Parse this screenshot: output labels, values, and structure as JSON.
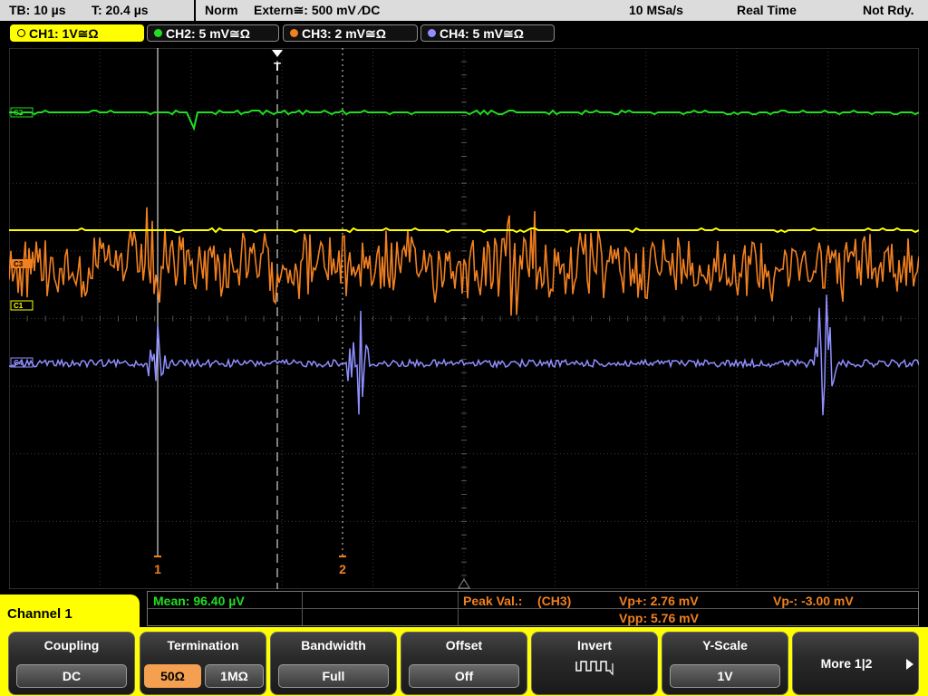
{
  "top": {
    "timebase": "TB: 10 µs",
    "trigger_pos": "T: 20.4 µs",
    "mode": "Norm",
    "trigger_src": "Extern≅: 500 mV ⁄DC",
    "sample_rate": "10 MSa/s",
    "acq_mode": "Real Time",
    "state": "Not Rdy."
  },
  "channels": [
    {
      "label": "CH1: 1V≅Ω",
      "color": "#ffff00",
      "active": true
    },
    {
      "label": "CH2: 5 mV≅Ω",
      "color": "#22dd22",
      "active": false
    },
    {
      "label": "CH3: 2 mV≅Ω",
      "color": "#f08020",
      "active": false
    },
    {
      "label": "CH4: 5 mV≅Ω",
      "color": "#8f8fff",
      "active": false
    }
  ],
  "markers": {
    "ch2": "C2",
    "ch3": "C3",
    "ch1": "C1",
    "ch4": "C4",
    "trigger": "T",
    "cursor1": "1",
    "cursor2": "2"
  },
  "measurements": {
    "mean": "Mean: 96.40 µV",
    "peak_label": "Peak Val.:",
    "peak_source": "(CH3)",
    "vp_plus": "Vp+: 2.76 mV",
    "vp_minus": "Vp-: -3.00 mV",
    "vpp": "Vpp: 5.76 mV"
  },
  "panel": {
    "title": "Channel 1"
  },
  "softkeys": {
    "coupling": {
      "title": "Coupling",
      "value": "DC"
    },
    "termination": {
      "title": "Termination",
      "opt1": "50Ω",
      "opt2": "1MΩ"
    },
    "bandwidth": {
      "title": "Bandwidth",
      "value": "Full"
    },
    "offset": {
      "title": "Offset",
      "value": "Off"
    },
    "invert": {
      "title": "Invert"
    },
    "yscale": {
      "title": "Y-Scale",
      "value": "1V"
    },
    "more": {
      "label": "More 1|2"
    }
  },
  "colors": {
    "ch1": "#ffff00",
    "ch2": "#22dd22",
    "ch3": "#f08020",
    "ch4": "#8f8fff",
    "accent": "#ffff00"
  }
}
